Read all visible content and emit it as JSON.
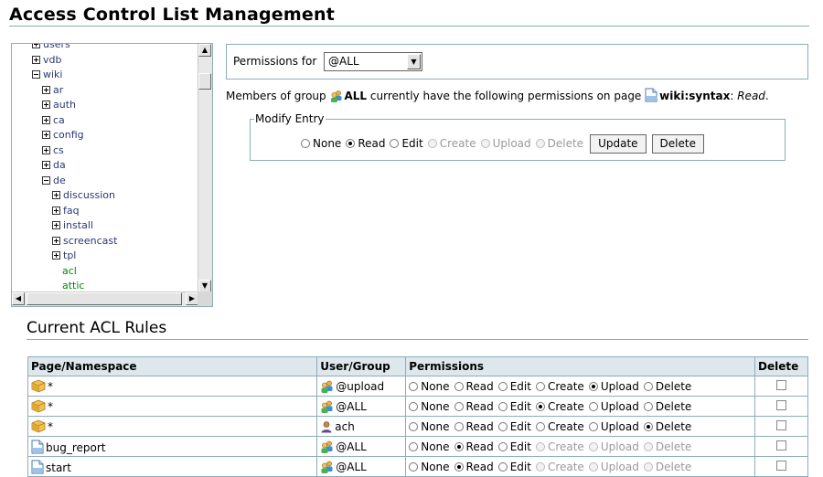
{
  "page_title": "Access Control List Management",
  "tree": {
    "nodes": [
      {
        "label": "users",
        "toggle": "plus",
        "level": 0,
        "cut": true
      },
      {
        "label": "vdb",
        "toggle": "plus",
        "level": 0
      },
      {
        "label": "wiki",
        "toggle": "minus",
        "level": 0
      },
      {
        "label": "ar",
        "toggle": "plus",
        "level": 1
      },
      {
        "label": "auth",
        "toggle": "plus",
        "level": 1
      },
      {
        "label": "ca",
        "toggle": "plus",
        "level": 1
      },
      {
        "label": "config",
        "toggle": "plus",
        "level": 1
      },
      {
        "label": "cs",
        "toggle": "plus",
        "level": 1
      },
      {
        "label": "da",
        "toggle": "plus",
        "level": 1
      },
      {
        "label": "de",
        "toggle": "minus",
        "level": 1
      },
      {
        "label": "discussion",
        "toggle": "plus",
        "level": 2
      },
      {
        "label": "faq",
        "toggle": "plus",
        "level": 2
      },
      {
        "label": "install",
        "toggle": "plus",
        "level": 2
      },
      {
        "label": "screencast",
        "toggle": "plus",
        "level": 2
      },
      {
        "label": "tpl",
        "toggle": "plus",
        "level": 2
      },
      {
        "label": "acl",
        "toggle": "none",
        "level": 2,
        "page": true
      },
      {
        "label": "attic",
        "toggle": "none",
        "level": 2,
        "page": true
      }
    ]
  },
  "permissions_for": {
    "label": "Permissions for",
    "selected": "@ALL"
  },
  "members_text": {
    "prefix": "Members of group",
    "group": "ALL",
    "middle": "currently have the following permissions on page",
    "page": "wiki:syntax",
    "colon": ":",
    "level": "Read",
    "end": "."
  },
  "modify_entry": {
    "legend": "Modify Entry",
    "options": [
      {
        "label": "None",
        "checked": false,
        "disabled": false
      },
      {
        "label": "Read",
        "checked": true,
        "disabled": false
      },
      {
        "label": "Edit",
        "checked": false,
        "disabled": false
      },
      {
        "label": "Create",
        "checked": false,
        "disabled": true
      },
      {
        "label": "Upload",
        "checked": false,
        "disabled": true
      },
      {
        "label": "Delete",
        "checked": false,
        "disabled": true
      }
    ],
    "update_label": "Update",
    "delete_label": "Delete"
  },
  "acl": {
    "heading": "Current ACL Rules",
    "columns": [
      "Page/Namespace",
      "User/Group",
      "Permissions",
      "Delete"
    ],
    "rows": [
      {
        "page": "*",
        "page_icon": "namespace-icon",
        "user": "@upload",
        "user_icon": "group-icon",
        "perms": [
          {
            "label": "None",
            "c": false,
            "d": false
          },
          {
            "label": "Read",
            "c": false,
            "d": false
          },
          {
            "label": "Edit",
            "c": false,
            "d": false
          },
          {
            "label": "Create",
            "c": false,
            "d": false
          },
          {
            "label": "Upload",
            "c": true,
            "d": false
          },
          {
            "label": "Delete",
            "c": false,
            "d": false
          }
        ]
      },
      {
        "page": "*",
        "page_icon": "namespace-icon",
        "user": "@ALL",
        "user_icon": "group-icon",
        "perms": [
          {
            "label": "None",
            "c": false,
            "d": false
          },
          {
            "label": "Read",
            "c": false,
            "d": false
          },
          {
            "label": "Edit",
            "c": false,
            "d": false
          },
          {
            "label": "Create",
            "c": true,
            "d": false
          },
          {
            "label": "Upload",
            "c": false,
            "d": false
          },
          {
            "label": "Delete",
            "c": false,
            "d": false
          }
        ]
      },
      {
        "page": "*",
        "page_icon": "namespace-icon",
        "user": "ach",
        "user_icon": "user-icon",
        "perms": [
          {
            "label": "None",
            "c": false,
            "d": false
          },
          {
            "label": "Read",
            "c": false,
            "d": false
          },
          {
            "label": "Edit",
            "c": false,
            "d": false
          },
          {
            "label": "Create",
            "c": false,
            "d": false
          },
          {
            "label": "Upload",
            "c": false,
            "d": false
          },
          {
            "label": "Delete",
            "c": true,
            "d": false
          }
        ]
      },
      {
        "page": "bug_report",
        "page_icon": "page-icon",
        "user": "@ALL",
        "user_icon": "group-icon",
        "perms": [
          {
            "label": "None",
            "c": false,
            "d": false
          },
          {
            "label": "Read",
            "c": true,
            "d": false
          },
          {
            "label": "Edit",
            "c": false,
            "d": false
          },
          {
            "label": "Create",
            "c": false,
            "d": true
          },
          {
            "label": "Upload",
            "c": false,
            "d": true
          },
          {
            "label": "Delete",
            "c": false,
            "d": true
          }
        ]
      },
      {
        "page": "start",
        "page_icon": "page-icon",
        "user": "@ALL",
        "user_icon": "group-icon",
        "perms": [
          {
            "label": "None",
            "c": false,
            "d": false
          },
          {
            "label": "Read",
            "c": true,
            "d": false
          },
          {
            "label": "Edit",
            "c": false,
            "d": false
          },
          {
            "label": "Create",
            "c": false,
            "d": true
          },
          {
            "label": "Upload",
            "c": false,
            "d": true
          },
          {
            "label": "Delete",
            "c": false,
            "d": true
          }
        ]
      }
    ]
  }
}
